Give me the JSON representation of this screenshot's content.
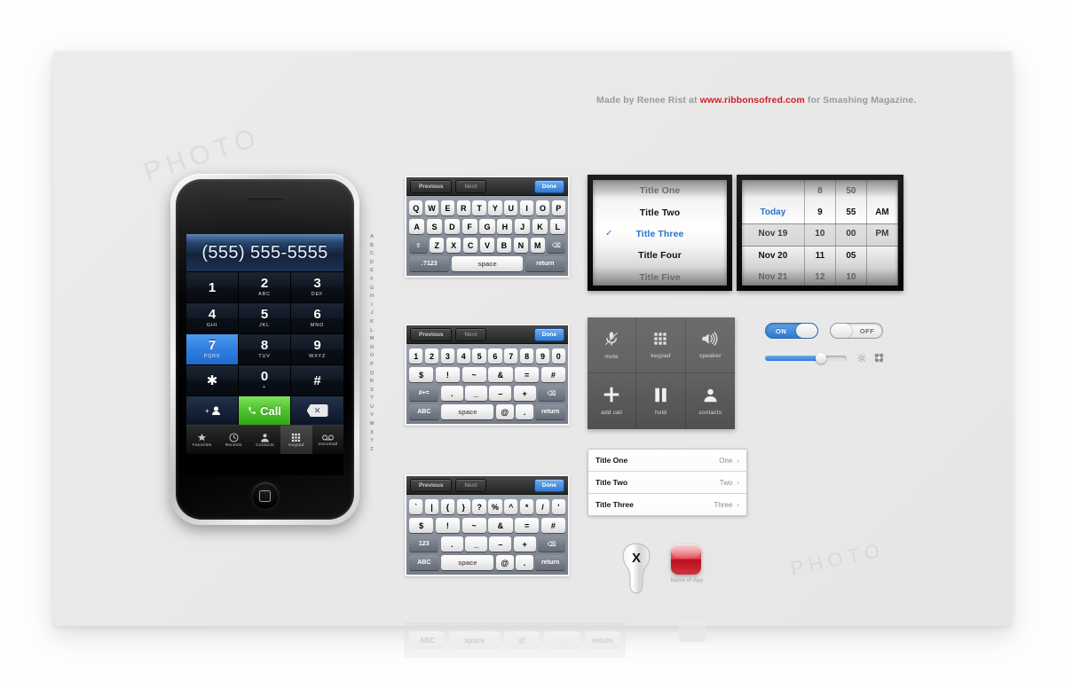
{
  "credit": {
    "prefix": "Made by Renee Rist at ",
    "url": "www.ribbonsofred.com",
    "suffix": " for Smashing Magazine."
  },
  "phone": {
    "display_number": "(555) 555-5555",
    "keys": [
      {
        "num": "1",
        "sub": ""
      },
      {
        "num": "2",
        "sub": "ABC"
      },
      {
        "num": "3",
        "sub": "DEF"
      },
      {
        "num": "4",
        "sub": "GHI"
      },
      {
        "num": "5",
        "sub": "JKL"
      },
      {
        "num": "6",
        "sub": "MNO"
      },
      {
        "num": "7",
        "sub": "PQRS"
      },
      {
        "num": "8",
        "sub": "TUV"
      },
      {
        "num": "9",
        "sub": "WXYZ"
      },
      {
        "num": "✱",
        "sub": ""
      },
      {
        "num": "0",
        "sub": "+"
      },
      {
        "num": "#",
        "sub": ""
      }
    ],
    "highlighted_key": "7",
    "call_label": "Call",
    "tabs": [
      {
        "label": "Favorites",
        "icon": "star-icon",
        "selected": false
      },
      {
        "label": "Recents",
        "icon": "clock-icon",
        "selected": false
      },
      {
        "label": "Contacts",
        "icon": "person-icon",
        "selected": false
      },
      {
        "label": "Keypad",
        "icon": "keypad-icon",
        "selected": true
      },
      {
        "label": "Voicemail",
        "icon": "voicemail-icon",
        "selected": false
      }
    ]
  },
  "alphabet_index": [
    "A",
    "B",
    "C",
    "D",
    "E",
    "F",
    "G",
    "H",
    "I",
    "J",
    "K",
    "L",
    "M",
    "N",
    "O",
    "P",
    "Q",
    "R",
    "S",
    "T",
    "U",
    "V",
    "W",
    "X",
    "Y",
    "Z"
  ],
  "keyboard_toolbar": {
    "previous": "Previous",
    "next": "Next",
    "done": "Done"
  },
  "keyboards": [
    {
      "id": "qwerty",
      "rows": [
        [
          "Q",
          "W",
          "E",
          "R",
          "T",
          "Y",
          "U",
          "I",
          "O",
          "P"
        ],
        [
          "A",
          "S",
          "D",
          "F",
          "G",
          "H",
          "J",
          "K",
          "L"
        ],
        [
          "⇧",
          "Z",
          "X",
          "C",
          "V",
          "B",
          "N",
          "M",
          "⌫"
        ],
        [
          ".?123",
          "space",
          "return"
        ]
      ]
    },
    {
      "id": "numeric",
      "rows": [
        [
          "1",
          "2",
          "3",
          "4",
          "5",
          "6",
          "7",
          "8",
          "9",
          "0"
        ],
        [
          "$",
          "!",
          "~",
          "&",
          "=",
          "#"
        ],
        [
          "#+=",
          ".",
          "_",
          "–",
          "+",
          "⌫"
        ],
        [
          "ABC",
          "space",
          "@",
          ".",
          "return"
        ]
      ]
    },
    {
      "id": "symbols",
      "rows": [
        [
          "`",
          "|",
          "{",
          "}",
          "?",
          "%",
          "^",
          "*",
          "/",
          "'"
        ],
        [
          "$",
          "!",
          "~",
          "&",
          "=",
          "#"
        ],
        [
          "123",
          ".",
          "_",
          "–",
          "+",
          "⌫"
        ],
        [
          "ABC",
          "space",
          "@",
          ".",
          "return"
        ]
      ]
    }
  ],
  "title_picker": {
    "options": [
      {
        "label": "Title One",
        "selected": false,
        "faded": true
      },
      {
        "label": "Title Two",
        "selected": false,
        "faded": false
      },
      {
        "label": "Title Three",
        "selected": true,
        "faded": false
      },
      {
        "label": "Title Four",
        "selected": false,
        "faded": false
      },
      {
        "label": "Title Five",
        "selected": false,
        "faded": true
      }
    ],
    "checkmark": "✓"
  },
  "date_picker": {
    "days": [
      "",
      "Today",
      "Nov 19",
      "Nov 20",
      "Nov 21"
    ],
    "hours": [
      "8",
      "9",
      "10",
      "11",
      "12"
    ],
    "minutes": [
      "50",
      "55",
      "00",
      "05",
      "10"
    ],
    "meridiem": [
      "",
      "AM",
      "PM",
      "",
      ""
    ],
    "selected_day": "Nov 19",
    "selected_hour": "10",
    "selected_minute": "00",
    "selected_meridiem": "PM"
  },
  "call_controls": [
    {
      "label": "mute",
      "icon": "mute-mic-icon"
    },
    {
      "label": "keypad",
      "icon": "keypad-grid-icon"
    },
    {
      "label": "speaker",
      "icon": "speaker-icon"
    },
    {
      "label": "add call",
      "icon": "plus-icon"
    },
    {
      "label": "hold",
      "icon": "pause-icon"
    },
    {
      "label": "contacts",
      "icon": "person-icon"
    }
  ],
  "table_list": {
    "rows": [
      {
        "title": "Title One",
        "value": "One"
      },
      {
        "title": "Title Two",
        "value": "Two"
      },
      {
        "title": "Title Three",
        "value": "Three"
      }
    ],
    "chevron": "›"
  },
  "switches": [
    {
      "label": "ON",
      "state": "on"
    },
    {
      "label": "OFF",
      "state": "off"
    }
  ],
  "slider": {
    "value_percent": 68,
    "left_icon": "brightness-icon",
    "right_icon": "brightness-max-icon"
  },
  "badges": {
    "delete_badge_letter": "X",
    "app_icon_label": "Name of App"
  },
  "faded_bar": {
    "keys": [
      "ABC",
      "space",
      "@",
      ".",
      "return"
    ]
  },
  "colors": {
    "accent_blue": "#2f79d4",
    "call_green": "#4cc22c",
    "credit_red": "#cf1f28",
    "canvas": "#e9e9e9",
    "keyboard_body": "#868c98"
  }
}
